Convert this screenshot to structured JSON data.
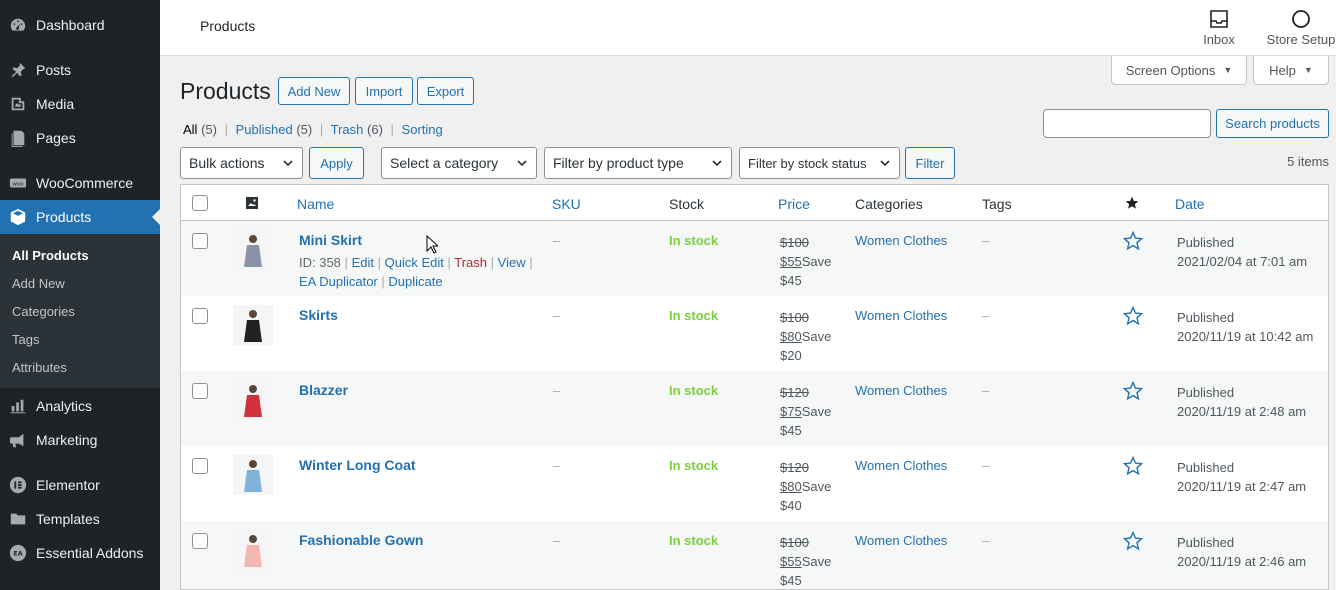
{
  "sidebar": {
    "items": [
      {
        "label": "Dashboard",
        "icon": "dashboard-icon"
      },
      {
        "label": "Posts",
        "icon": "pin-icon"
      },
      {
        "label": "Media",
        "icon": "media-icon"
      },
      {
        "label": "Pages",
        "icon": "pages-icon"
      },
      {
        "label": "WooCommerce",
        "icon": "woocommerce-icon"
      },
      {
        "label": "Products",
        "icon": "products-icon"
      },
      {
        "label": "Analytics",
        "icon": "analytics-icon"
      },
      {
        "label": "Marketing",
        "icon": "marketing-icon"
      },
      {
        "label": "Elementor",
        "icon": "elementor-icon"
      },
      {
        "label": "Templates",
        "icon": "folder-icon"
      },
      {
        "label": "Essential Addons",
        "icon": "essential-addons-icon"
      }
    ],
    "submenu": [
      "All Products",
      "Add New",
      "Categories",
      "Tags",
      "Attributes"
    ]
  },
  "topbar": {
    "title": "Products",
    "inbox_label": "Inbox",
    "store_setup_label": "Store Setup"
  },
  "tabs": {
    "screen_options": "Screen Options",
    "help": "Help"
  },
  "heading": {
    "title": "Products",
    "add_new": "Add New",
    "import": "Import",
    "export": "Export"
  },
  "views": {
    "all": "All",
    "all_count": "(5)",
    "published": "Published",
    "published_count": "(5)",
    "trash": "Trash",
    "trash_count": "(6)",
    "sorting": "Sorting",
    "separator": "|"
  },
  "search": {
    "value": "",
    "button": "Search products"
  },
  "filters": {
    "bulk_actions": "Bulk actions",
    "apply": "Apply",
    "category": "Select a category",
    "product_type": "Filter by product type",
    "stock_status": "Filter by stock status",
    "filter": "Filter",
    "items_count": "5 items"
  },
  "table": {
    "headers": {
      "name": "Name",
      "sku": "SKU",
      "stock": "Stock",
      "price": "Price",
      "categories": "Categories",
      "tags": "Tags",
      "date": "Date"
    },
    "row_actions": {
      "id": "ID: 358",
      "edit": "Edit",
      "quick_edit": "Quick Edit",
      "trash": "Trash",
      "view": "View",
      "ea_duplicator": "EA Duplicator",
      "duplicate": "Duplicate",
      "sep": "|"
    },
    "rows": [
      {
        "name": "Mini Skirt",
        "sku": "–",
        "stock": "In stock",
        "regular": "$100",
        "sale": "$55",
        "save": "Save",
        "save_amount": "$45",
        "category": "Women Clothes",
        "tags": "–",
        "status": "Published",
        "date": "2021/02/04 at 7:01 am",
        "thumb_color": "#8a93a6"
      },
      {
        "name": "Skirts",
        "sku": "–",
        "stock": "In stock",
        "regular": "$100",
        "sale": "$80",
        "save": "Save",
        "save_amount": "$20",
        "category": "Women Clothes",
        "tags": "–",
        "status": "Published",
        "date": "2020/11/19 at 10:42 am",
        "thumb_color": "#222222"
      },
      {
        "name": "Blazzer",
        "sku": "–",
        "stock": "In stock",
        "regular": "$120",
        "sale": "$75",
        "save": "Save",
        "save_amount": "$45",
        "category": "Women Clothes",
        "tags": "–",
        "status": "Published",
        "date": "2020/11/19 at 2:48 am",
        "thumb_color": "#d0313a"
      },
      {
        "name": "Winter Long Coat",
        "sku": "–",
        "stock": "In stock",
        "regular": "$120",
        "sale": "$80",
        "save": "Save",
        "save_amount": "$40",
        "category": "Women Clothes",
        "tags": "–",
        "status": "Published",
        "date": "2020/11/19 at 2:47 am",
        "thumb_color": "#7fb3d8"
      },
      {
        "name": "Fashionable Gown",
        "sku": "–",
        "stock": "In stock",
        "regular": "$100",
        "sale": "$55",
        "save": "Save",
        "save_amount": "$45",
        "category": "Women Clothes",
        "tags": "–",
        "status": "Published",
        "date": "2020/11/19 at 2:46 am",
        "thumb_color": "#f1b7b0"
      }
    ]
  }
}
